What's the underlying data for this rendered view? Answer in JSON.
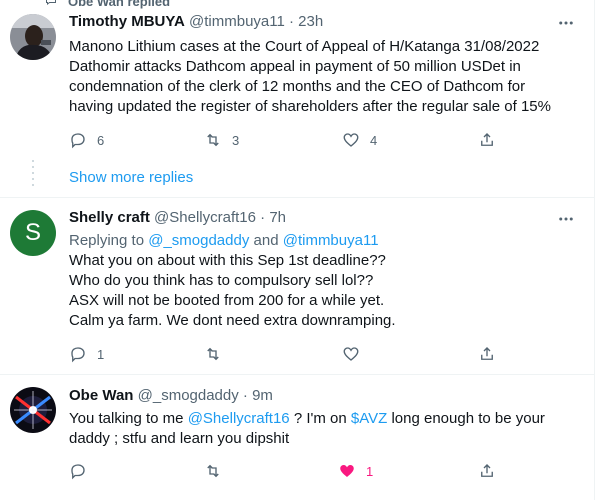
{
  "context": {
    "label": "Obe Wan replied"
  },
  "tweets": [
    {
      "name": "Timothy MBUYA",
      "handle": "@timmbuya11 · 23h",
      "lines": [
        "Manono Lithium cases at the Court of Appeal of H/Katanga 31/08/2022",
        "Dathomir attacks Dathcom appeal in payment of 50 million USDet in",
        "condemnation of the clerk of 12 months and the CEO of Dathcom for",
        "having updated the register of shareholders after the regular sale of 15%"
      ],
      "replies": "6",
      "retweets": "3",
      "likes": "4"
    },
    {
      "name": "Shelly craft",
      "handle": "@Shellycraft16 · 7h",
      "avatar_letter": "S",
      "reply_prefix": "Replying to ",
      "reply_user1": "@_smogdaddy",
      "reply_and": " and ",
      "reply_user2": "@timmbuya11",
      "lines": [
        "What you on about with this Sep 1st deadline??",
        "Who do you think has to compulsory sell lol??",
        "ASX will not be booted from 200 for a while yet.",
        "Calm ya farm. We dont need extra downramping."
      ],
      "replies": "1",
      "retweets": "",
      "likes": ""
    },
    {
      "name": "Obe Wan",
      "handle": "@_smogdaddy · 9m",
      "text_a": "You talking to me ",
      "mention": "@Shellycraft16",
      "text_b": " ? I'm on ",
      "cashtag": "$AVZ",
      "text_c": " long enough to be your",
      "line2": "daddy ; stfu and learn you dipshit",
      "replies": "",
      "retweets": "",
      "likes": "1"
    }
  ],
  "show_more": "Show more replies",
  "colors": {
    "accent": "#1d9bf0",
    "like": "#f91880",
    "avatar_green": "#1e7a36",
    "muted": "#536471"
  }
}
